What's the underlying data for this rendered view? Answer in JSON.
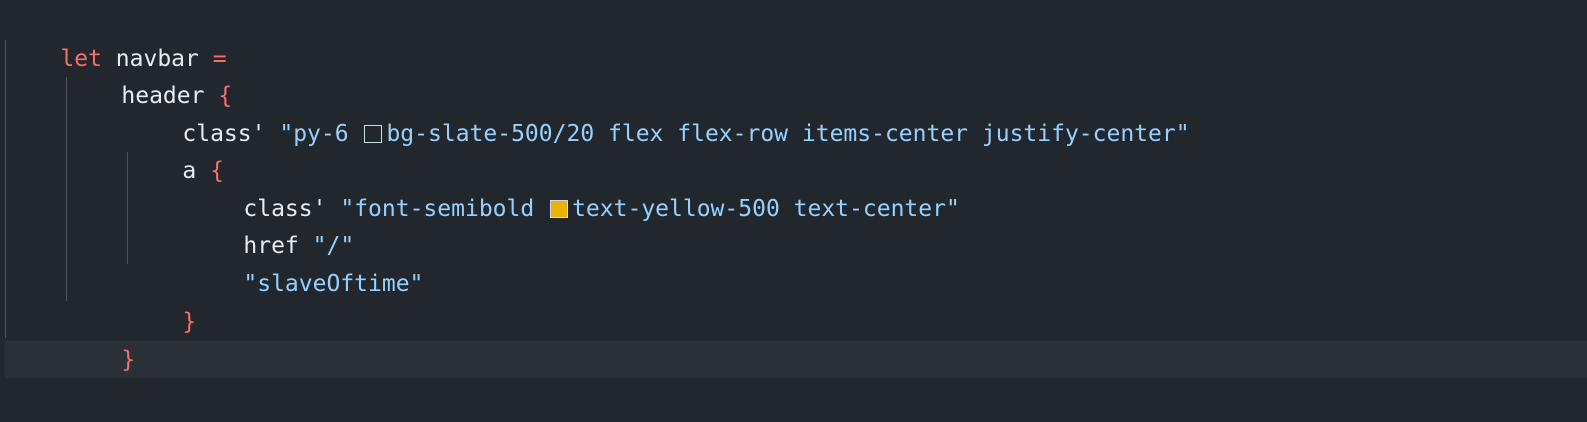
{
  "editor": {
    "colors": {
      "background": "#22272e",
      "keyword": "#f47067",
      "string": "#96d0ff",
      "identifier": "#e6edf3",
      "swatch_slate": "#22272e",
      "swatch_yellow": "#eab308"
    },
    "lines": [
      {
        "kw": "let",
        "ident": "navbar",
        "op": "="
      },
      {
        "ident": "header",
        "brace": "{"
      },
      {
        "ident": "class'",
        "str_pre": "\"py-6",
        "str_post": "bg-slate-500/20 flex flex-row items-center justify-center\""
      },
      {
        "ident": "a",
        "brace": "{"
      },
      {
        "ident": "class'",
        "str_pre": "\"font-semibold",
        "str_post": "text-yellow-500 text-center\""
      },
      {
        "ident": "href",
        "str": "\"/\""
      },
      {
        "str": "\"slaveOftime\""
      },
      {
        "brace": "}"
      },
      {
        "brace": "}"
      }
    ]
  }
}
